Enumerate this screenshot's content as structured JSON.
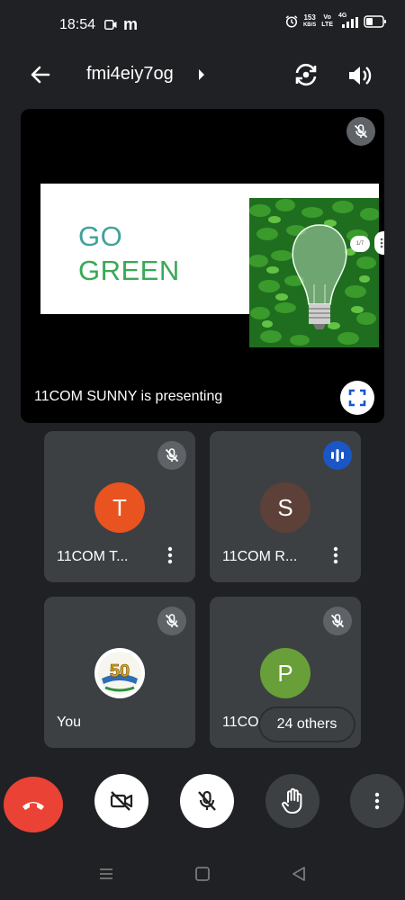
{
  "status_bar": {
    "time": "18:54",
    "app_letter": "m",
    "speed_value": "153",
    "speed_unit": "KB/S",
    "volte_top": "Vo",
    "volte_bottom": "LTE",
    "network": "4G"
  },
  "header": {
    "meeting_code": "fmi4eiy7og",
    "icons": [
      "back-arrow-icon",
      "caret-right-icon",
      "switch-camera-icon",
      "speaker-icon"
    ]
  },
  "presentation": {
    "slide_line1": "GO",
    "slide_line2": "GREEN",
    "slide_pager": "1/7",
    "caption": "11COM SUNNY is presenting",
    "colors": {
      "go": "#3fa39a",
      "green": "#39a957"
    }
  },
  "participants": [
    {
      "name": "11COM T...",
      "initial": "T",
      "avatar_color": "#e8531f",
      "status": "muted"
    },
    {
      "name": "11COM R...",
      "initial": "S",
      "avatar_color": "#5d4037",
      "status": "speaking"
    },
    {
      "name": "You",
      "initial": "",
      "avatar_badge": "50",
      "status": "muted"
    },
    {
      "name": "11COM SUNNY",
      "initial": "P",
      "avatar_color": "#689f38",
      "status": "muted"
    }
  ],
  "others_chip": "24 others",
  "controls": [
    {
      "name": "end-call",
      "color": "#ea4335"
    },
    {
      "name": "camera-off",
      "color": "#ffffff"
    },
    {
      "name": "mic-off",
      "color": "#ffffff"
    },
    {
      "name": "raise-hand",
      "color": "#3c4043"
    },
    {
      "name": "more-options",
      "color": "#3c4043"
    }
  ],
  "nav_bar": [
    "recents-icon",
    "home-icon",
    "back-triangle-icon"
  ]
}
